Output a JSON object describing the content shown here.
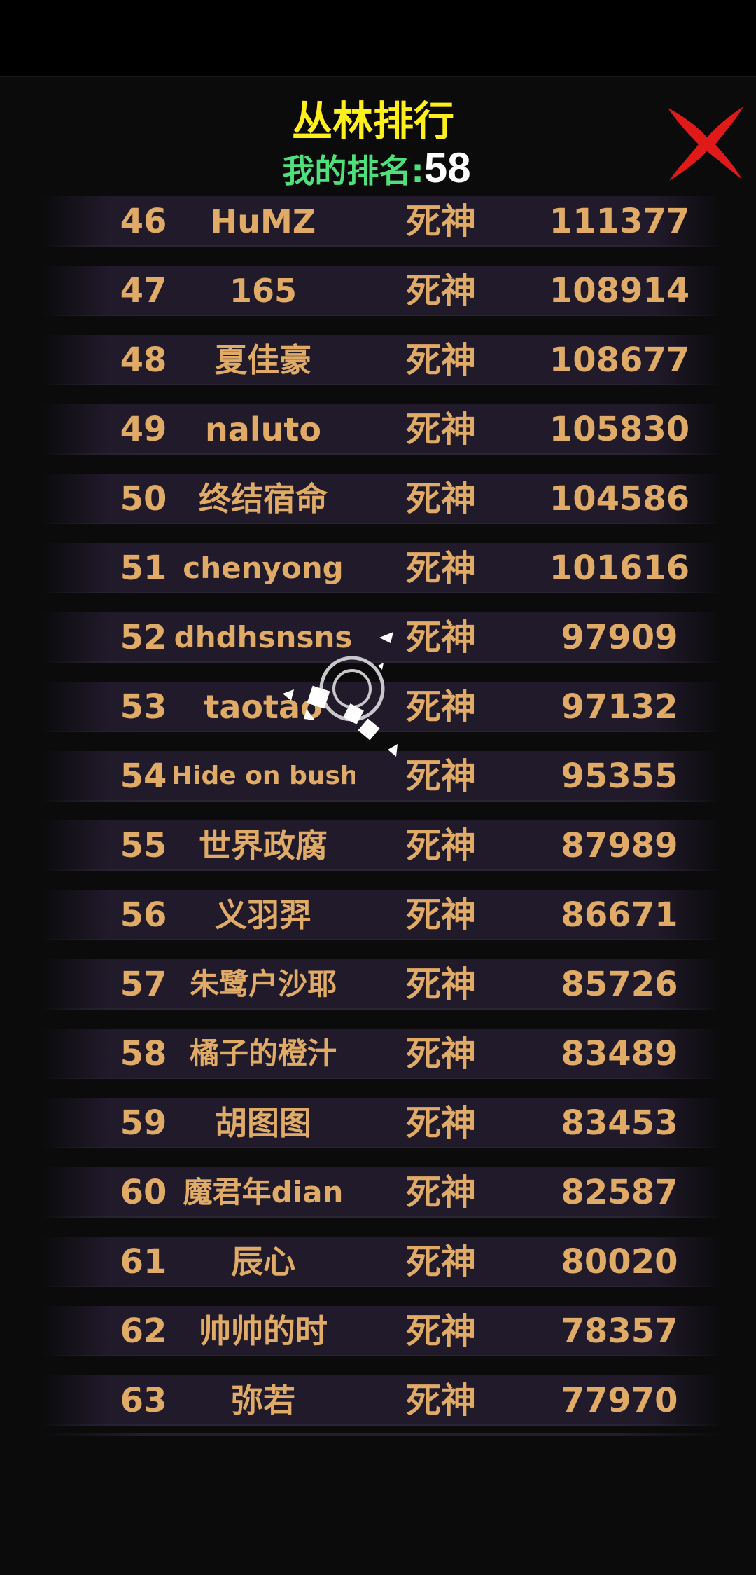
{
  "header": {
    "title": "丛林排行",
    "my_rank_label": "我的排名:",
    "my_rank_value": "58"
  },
  "icons": {
    "close": "close-x-icon",
    "loading": "loading-spinner-icon"
  },
  "colors": {
    "title": "#ffef1a",
    "my_rank_label": "#4ee07a",
    "row_text": "#e0ab66",
    "row_background": "#211a2b",
    "close": "#e01919"
  },
  "leaderboard": {
    "rows": [
      {
        "rank": "46",
        "name": "HuMZ",
        "title": "死神",
        "score": "111377"
      },
      {
        "rank": "47",
        "name": "165",
        "title": "死神",
        "score": "108914"
      },
      {
        "rank": "48",
        "name": "夏佳豪",
        "title": "死神",
        "score": "108677"
      },
      {
        "rank": "49",
        "name": "naluto",
        "title": "死神",
        "score": "105830"
      },
      {
        "rank": "50",
        "name": "终结宿命",
        "title": "死神",
        "score": "104586"
      },
      {
        "rank": "51",
        "name": "chenyong",
        "title": "死神",
        "score": "101616"
      },
      {
        "rank": "52",
        "name": "dhdhsnsns",
        "title": "死神",
        "score": "97909"
      },
      {
        "rank": "53",
        "name": "taotao",
        "title": "死神",
        "score": "97132"
      },
      {
        "rank": "54",
        "name": "Hide on bushi",
        "title": "死神",
        "score": "95355"
      },
      {
        "rank": "55",
        "name": "世界政腐",
        "title": "死神",
        "score": "87989"
      },
      {
        "rank": "56",
        "name": "义羽羿",
        "title": "死神",
        "score": "86671"
      },
      {
        "rank": "57",
        "name": "朱鹭户沙耶",
        "title": "死神",
        "score": "85726"
      },
      {
        "rank": "58",
        "name": "橘子的橙汁",
        "title": "死神",
        "score": "83489"
      },
      {
        "rank": "59",
        "name": "胡图图",
        "title": "死神",
        "score": "83453"
      },
      {
        "rank": "60",
        "name": "魔君年dian",
        "title": "死神",
        "score": "82587"
      },
      {
        "rank": "61",
        "name": "辰心",
        "title": "死神",
        "score": "80020"
      },
      {
        "rank": "62",
        "name": "帅帅的时",
        "title": "死神",
        "score": "78357"
      },
      {
        "rank": "63",
        "name": "弥若",
        "title": "死神",
        "score": "77970"
      }
    ]
  }
}
